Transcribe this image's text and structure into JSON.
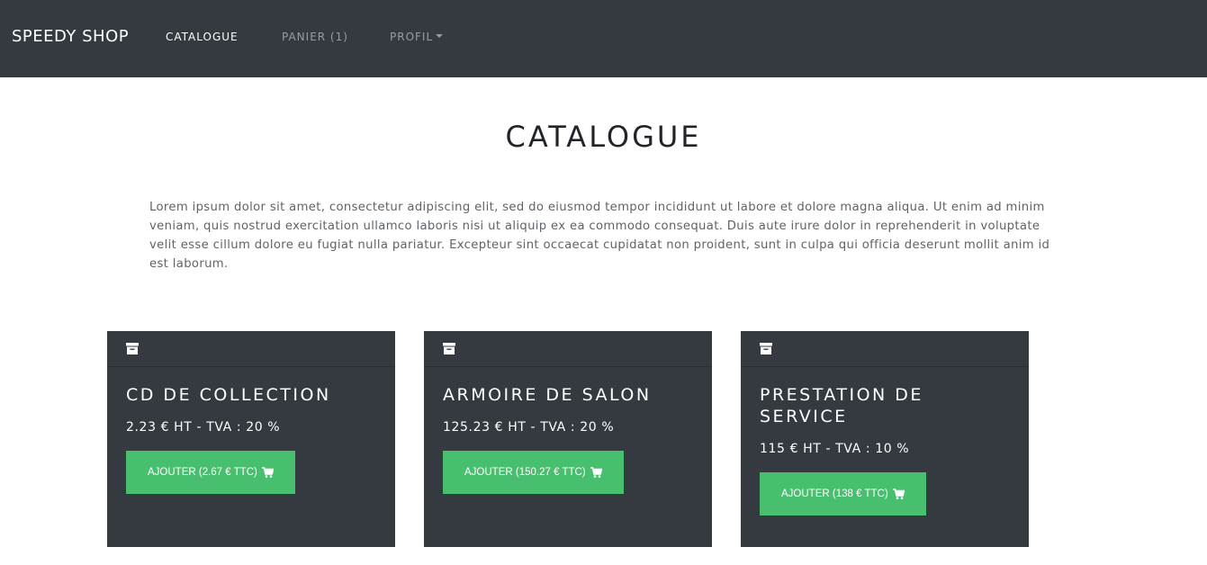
{
  "navbar": {
    "brand": "SPEEDY SHOP",
    "links": [
      {
        "label": "CATALOGUE",
        "active": true
      },
      {
        "label": "PANIER (1)",
        "active": false
      },
      {
        "label": "PROFIL",
        "active": false,
        "dropdown": true
      }
    ]
  },
  "page": {
    "title": "CATALOGUE",
    "intro": "Lorem ipsum dolor sit amet, consectetur adipiscing elit, sed do eiusmod tempor incididunt ut labore et dolore magna aliqua. Ut enim ad minim veniam, quis nostrud exercitation ullamco laboris nisi ut aliquip ex ea commodo consequat. Duis aute irure dolor in reprehenderit in voluptate velit esse cillum dolore eu fugiat nulla pariatur. Excepteur sint occaecat cupidatat non proident, sunt in culpa qui officia deserunt mollit anim id est laborum."
  },
  "products": [
    {
      "name": "CD DE COLLECTION",
      "price": "2.23 € HT - TVA : 20 %",
      "button": "AJOUTER (2.67 € TTC)"
    },
    {
      "name": "ARMOIRE DE SALON",
      "price": "125.23 € HT - TVA : 20 %",
      "button": "AJOUTER (150.27 € TTC)"
    },
    {
      "name": "PRESTATION DE SERVICE",
      "price": "115 € HT - TVA : 10 %",
      "button": "AJOUTER (138 € TTC)"
    }
  ],
  "icons": {
    "card_header": "archive-box-icon",
    "add_button": "shopping-cart-icon"
  },
  "colors": {
    "navbar_bg": "#343a40",
    "card_bg": "#343a40",
    "button_green": "#48bf6e"
  }
}
